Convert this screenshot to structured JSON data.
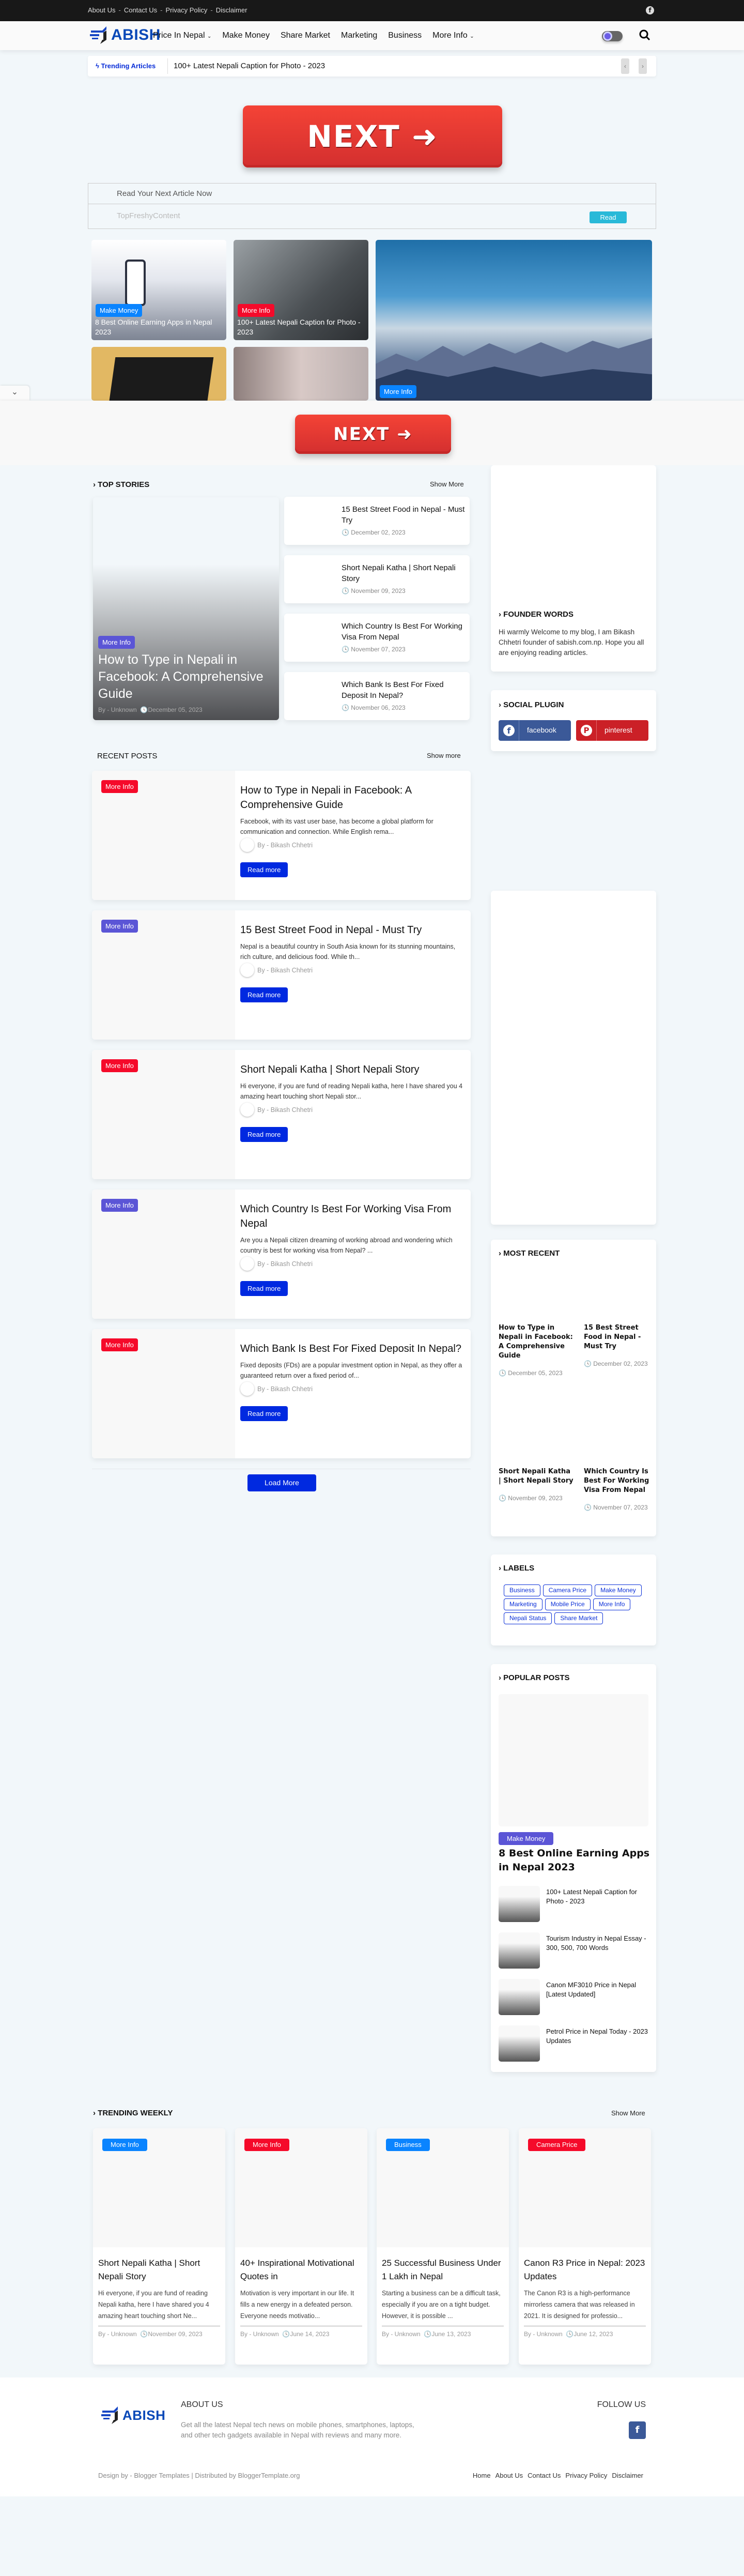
{
  "topbar": {
    "links": [
      "About Us",
      "Contact Us",
      "Privacy Policy",
      "Disclaimer"
    ],
    "separator": "-",
    "social_icon": "facebook-icon"
  },
  "logo": {
    "text": "ABISH"
  },
  "nav": {
    "items": [
      {
        "label": "Price In Nepal",
        "dropdown": true
      },
      {
        "label": "Make Money"
      },
      {
        "label": "Share Market"
      },
      {
        "label": "Marketing"
      },
      {
        "label": "Business"
      },
      {
        "label": "More Info",
        "dropdown": true
      }
    ]
  },
  "trending_bar": {
    "label": "Trending Articles",
    "title": "100+ Latest Nepali Caption for Photo - 2023"
  },
  "next_button": {
    "label": "NEXT ➜"
  },
  "read_box": {
    "heading": "Read Your Next Article Now",
    "source": "TopFreshyContent",
    "button": "Read"
  },
  "featured": [
    {
      "badge": "Make Money",
      "badge_color": "#0a84ff",
      "title": "8 Best Online Earning Apps in Nepal 2023"
    },
    {
      "badge": "More Info",
      "badge_color": "#f50a2a",
      "title": "100+ Latest Nepali Caption for Photo - 2023"
    },
    {
      "badge": "More Info",
      "badge_color": "#0a84ff",
      "title": ""
    }
  ],
  "top_stories": {
    "heading": "TOP STORIES",
    "show_more": "Show More",
    "main": {
      "badge": "More Info",
      "title": "How to Type in Nepali in Facebook: A Comprehensive Guide",
      "author": "By - Unknown",
      "date": "December 05, 2023"
    },
    "items": [
      {
        "title": "15 Best Street Food in Nepal - Must Try",
        "date": "December 02, 2023"
      },
      {
        "title": "Short Nepali Katha | Short Nepali Story",
        "date": "November 09, 2023"
      },
      {
        "title": "Which Country Is Best For Working Visa From Nepal",
        "date": "November 07, 2023"
      },
      {
        "title": "Which Bank Is Best For Fixed Deposit In Nepal?",
        "date": "November 06, 2023"
      }
    ]
  },
  "recent_posts": {
    "heading": "RECENT POSTS",
    "show_more": "Show more",
    "read_more": "Read more",
    "load_more": "Load More",
    "items": [
      {
        "badge": "More Info",
        "badge_color": "#f50a2a",
        "title": "How to Type in Nepali in Facebook: A Comprehensive Guide",
        "excerpt": "Facebook, with its vast user base, has become a global platform for communication and connection. While English rema...",
        "author": "By - Bikash Chhetri"
      },
      {
        "badge": "More Info",
        "badge_color": "#5b55d6",
        "title": "15 Best Street Food in Nepal - Must Try",
        "excerpt": "Nepal is a beautiful country in South Asia known for its stunning mountains, rich culture, and delicious food. While th...",
        "author": "By - Bikash Chhetri"
      },
      {
        "badge": "More Info",
        "badge_color": "#f50a2a",
        "title": "Short Nepali Katha | Short Nepali Story",
        "excerpt": "Hi everyone, if you are fund of reading Nepali katha, here I have shared you 4 amazing heart touching short Nepali stor...",
        "author": "By - Bikash Chhetri"
      },
      {
        "badge": "More Info",
        "badge_color": "#5b55d6",
        "title": "Which Country Is Best For Working Visa From Nepal",
        "excerpt": "Are you a Nepali citizen dreaming of working abroad and wondering which country is best for working visa from Nepal? ...",
        "author": "By - Bikash Chhetri"
      },
      {
        "badge": "More Info",
        "badge_color": "#f50a2a",
        "title": "Which Bank Is Best For Fixed Deposit In Nepal?",
        "excerpt": "Fixed deposits (FDs) are a popular investment option in Nepal, as they offer a guaranteed return over a fixed period of...",
        "author": "By - Bikash Chhetri"
      }
    ]
  },
  "sidebar": {
    "founder": {
      "heading": "FOUNDER WORDS",
      "text": "Hi warmly Welcome to my blog, I am Bikash Chhetri founder of sabish.com.np. Hope you all are enjoying reading articles."
    },
    "social": {
      "heading": "SOCIAL PLUGIN",
      "buttons": [
        {
          "label": "facebook",
          "color": "#3b5998"
        },
        {
          "label": "pinterest",
          "color": "#cb2027"
        }
      ]
    },
    "most_recent": {
      "heading": "MOST RECENT",
      "items": [
        {
          "title": "How to Type in Nepali in Facebook: A Comprehensive Guide",
          "date": "December 05, 2023"
        },
        {
          "title": "15 Best Street Food in Nepal - Must Try",
          "date": "December 02, 2023"
        },
        {
          "title": "Short Nepali Katha | Short Nepali Story",
          "date": "November 09, 2023"
        },
        {
          "title": "Which Country Is Best For Working Visa From Nepal",
          "date": "November 07, 2023"
        }
      ]
    },
    "labels": {
      "heading": "LABELS",
      "items": [
        "Business",
        "Camera Price",
        "Make Money",
        "Marketing",
        "Mobile Price",
        "More Info",
        "Nepali Status",
        "Share Market"
      ]
    },
    "popular": {
      "heading": "POPULAR POSTS",
      "main": {
        "badge": "Make Money",
        "title": "8 Best Online Earning Apps in Nepal 2023"
      },
      "items": [
        "100+ Latest Nepali Caption for Photo - 2023",
        "Tourism Industry in Nepal Essay - 300, 500, 700 Words",
        "Canon MF3010 Price in Nepal [Latest Updated]",
        "Petrol Price in Nepal Today - 2023 Updates"
      ]
    }
  },
  "trending_weekly": {
    "heading": "TRENDING WEEKLY",
    "show_more": "Show More",
    "items": [
      {
        "badge": "More Info",
        "badge_color": "#0a84ff",
        "title": "Short Nepali Katha | Short Nepali Story",
        "excerpt": "Hi everyone, if you are fund of reading Nepali katha, here I have shared you 4 amazing heart touching short Ne...",
        "author": "By - Unknown",
        "date": "November 09, 2023"
      },
      {
        "badge": "More Info",
        "badge_color": "#f50a2a",
        "title": "40+ Inspirational Motivational Quotes in",
        "excerpt": "Motivation is very important in our life. It fills a new energy in a defeated person. Everyone needs motivatio...",
        "author": "By - Unknown",
        "date": "June 14, 2023"
      },
      {
        "badge": "Business",
        "badge_color": "#0a84ff",
        "title": "25 Successful Business Under 1 Lakh in Nepal",
        "excerpt": "Starting a business can be a difficult task, especially if you are on a tight budget. However, it is possible ...",
        "author": "By - Unknown",
        "date": "June 13, 2023"
      },
      {
        "badge": "Camera Price",
        "badge_color": "#f50a2a",
        "title": "Canon R3 Price in Nepal: 2023 Updates",
        "excerpt": "The Canon R3 is a high-performance mirrorless camera that was released in 2021. It is designed for professio...",
        "author": "By - Unknown",
        "date": "June 12, 2023"
      }
    ]
  },
  "footer": {
    "about_heading": "ABOUT US",
    "about_text": "Get all the latest Nepal tech news on mobile phones, smartphones, laptops, and other tech gadgets available in Nepal with reviews and many more.",
    "follow_heading": "FOLLOW US",
    "credit": "Design by - Blogger Templates | Distributed by BloggerTemplate.org",
    "links": [
      "Home",
      "About Us",
      "Contact Us",
      "Privacy Policy",
      "Disclaimer"
    ]
  }
}
